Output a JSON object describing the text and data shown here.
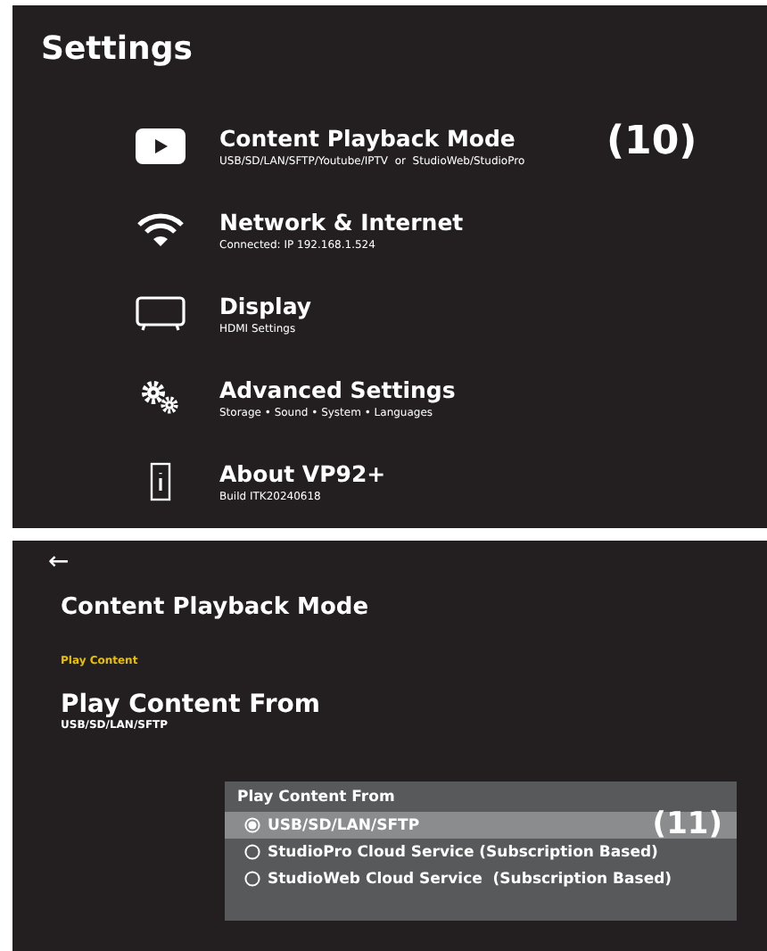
{
  "settings_screen": {
    "title": "Settings",
    "callout": "(10)",
    "items": [
      {
        "kind": "play",
        "title": "Content Playback Mode",
        "subtitle": "USB/SD/LAN/SFTP/Youtube/IPTV  or  StudioWeb/StudioPro"
      },
      {
        "kind": "wifi",
        "title": "Network & Internet",
        "subtitle": "Connected: IP 192.168.1.524"
      },
      {
        "kind": "tv",
        "title": "Display",
        "subtitle": "HDMI Settings"
      },
      {
        "kind": "gears",
        "title": "Advanced Settings",
        "subtitle": "Storage • Sound • System • Languages"
      },
      {
        "kind": "info",
        "title": "About VP92+",
        "subtitle": "Build ITK20240618"
      }
    ]
  },
  "playback_screen": {
    "back": "←",
    "title": "Content Playback Mode",
    "section": "Play Content",
    "setting_title": "Play Content From",
    "setting_value": "USB/SD/LAN/SFTP",
    "dialog": {
      "title": "Play Content From",
      "callout": "(11)",
      "options": [
        {
          "label": "USB/SD/LAN/SFTP",
          "selected": true
        },
        {
          "label": "StudioPro Cloud Service (Subscription Based)",
          "selected": false
        },
        {
          "label": "StudioWeb Cloud Service  (Subscription Based)",
          "selected": false
        }
      ]
    }
  }
}
